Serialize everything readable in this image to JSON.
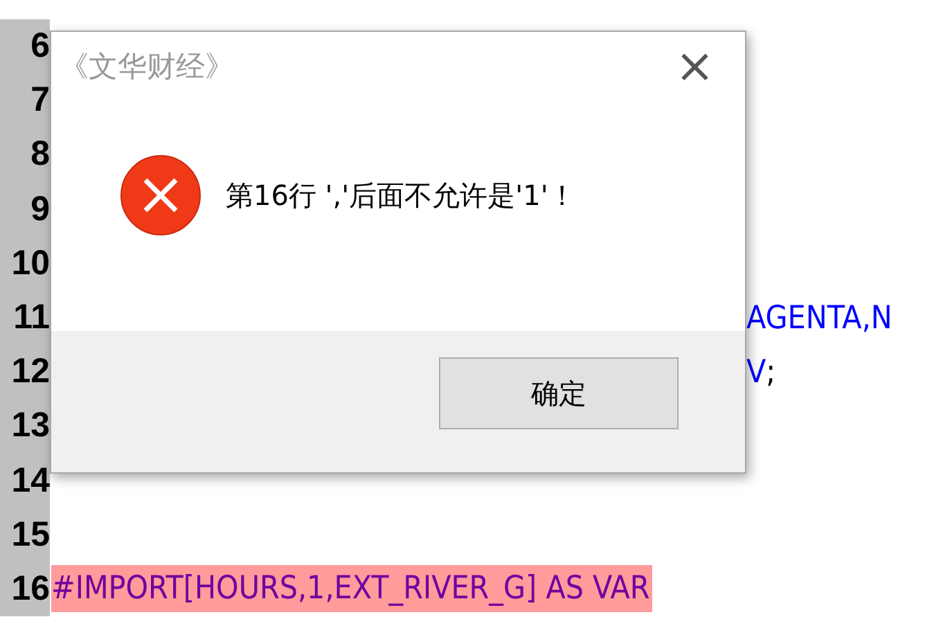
{
  "editor": {
    "lines": [
      {
        "number": "6",
        "highlighted": false
      },
      {
        "number": "7",
        "highlighted": false
      },
      {
        "number": "8",
        "highlighted": false
      },
      {
        "number": "9",
        "highlighted": false
      },
      {
        "number": "10",
        "highlighted": false
      },
      {
        "number": "11",
        "text": "AGENTA,N",
        "highlighted": false
      },
      {
        "number": "12",
        "text": "V",
        "suffix": ";",
        "highlighted": false
      },
      {
        "number": "13",
        "highlighted": false
      },
      {
        "number": "14",
        "highlighted": false
      },
      {
        "number": "15",
        "highlighted": false
      },
      {
        "number": "16",
        "text": "#IMPORT[HOURS,1,EXT_RIVER_G] AS VAR",
        "highlighted": true
      }
    ]
  },
  "dialog": {
    "title": "《文华财经》",
    "close": "×",
    "message": "第16行 ','后面不允许是'1'！",
    "buttons": [
      "确定"
    ]
  }
}
